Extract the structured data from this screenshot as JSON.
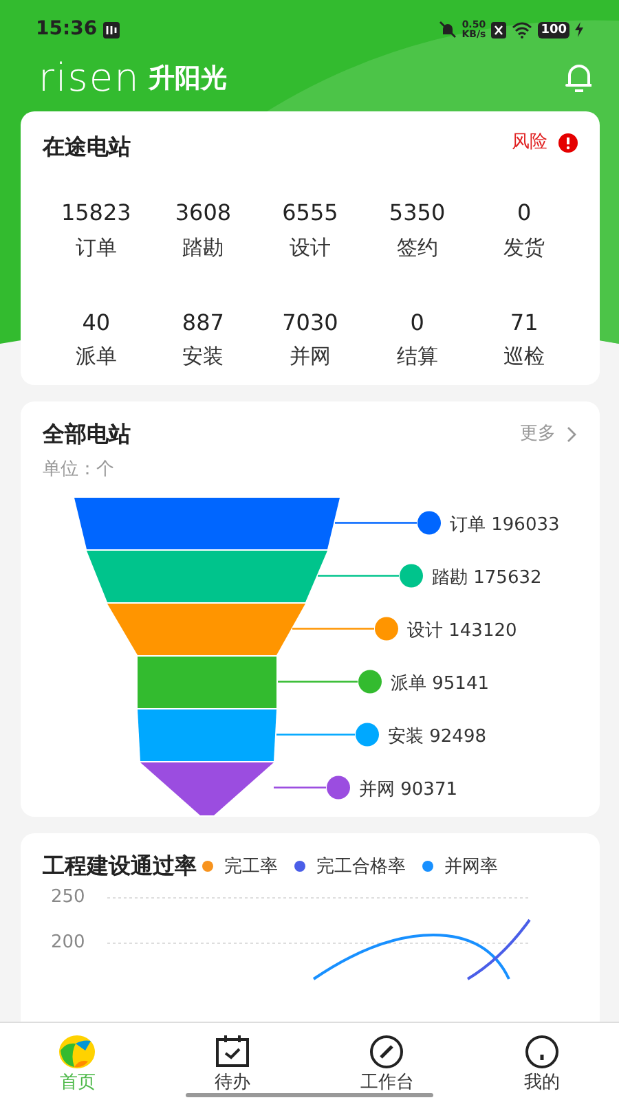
{
  "status_bar": {
    "time": "15:36",
    "net_speed": "0.50",
    "net_unit": "KB/s",
    "battery": "100"
  },
  "header": {
    "logo": "risen",
    "logo_cn": "升阳光"
  },
  "transit_card": {
    "title": "在途电站",
    "risk": "风险",
    "stats": [
      {
        "value": "15823",
        "label": "订单"
      },
      {
        "value": "3608",
        "label": "踏勘"
      },
      {
        "value": "6555",
        "label": "设计"
      },
      {
        "value": "5350",
        "label": "签约"
      },
      {
        "value": "0",
        "label": "发货"
      },
      {
        "value": "40",
        "label": "派单"
      },
      {
        "value": "887",
        "label": "安装"
      },
      {
        "value": "7030",
        "label": "并网"
      },
      {
        "value": "0",
        "label": "结算"
      },
      {
        "value": "71",
        "label": "巡检"
      }
    ]
  },
  "all_card": {
    "title": "全部电站",
    "more": "更多",
    "unit": "单位：个",
    "funnel": [
      {
        "label": "订单 196033",
        "color": "#0066ff"
      },
      {
        "label": "踏勘 175632",
        "color": "#00c48c"
      },
      {
        "label": "设计 143120",
        "color": "#ff9500"
      },
      {
        "label": "派单 95141",
        "color": "#33bb2f"
      },
      {
        "label": "安装 92498",
        "color": "#00a8ff"
      },
      {
        "label": "并网 90371",
        "color": "#9b4de0"
      }
    ]
  },
  "rate_card": {
    "title": "工程建设通过率",
    "legend": [
      {
        "label": "完工率",
        "color": "#f7931e"
      },
      {
        "label": "完工合格率",
        "color": "#4a5ee8"
      },
      {
        "label": "并网率",
        "color": "#1890ff"
      }
    ],
    "y_labels": [
      "250",
      "200"
    ]
  },
  "bottom_nav": [
    {
      "label": "首页",
      "selected": true
    },
    {
      "label": "待办",
      "selected": false
    },
    {
      "label": "工作台",
      "selected": false
    },
    {
      "label": "我的",
      "selected": false
    }
  ]
}
